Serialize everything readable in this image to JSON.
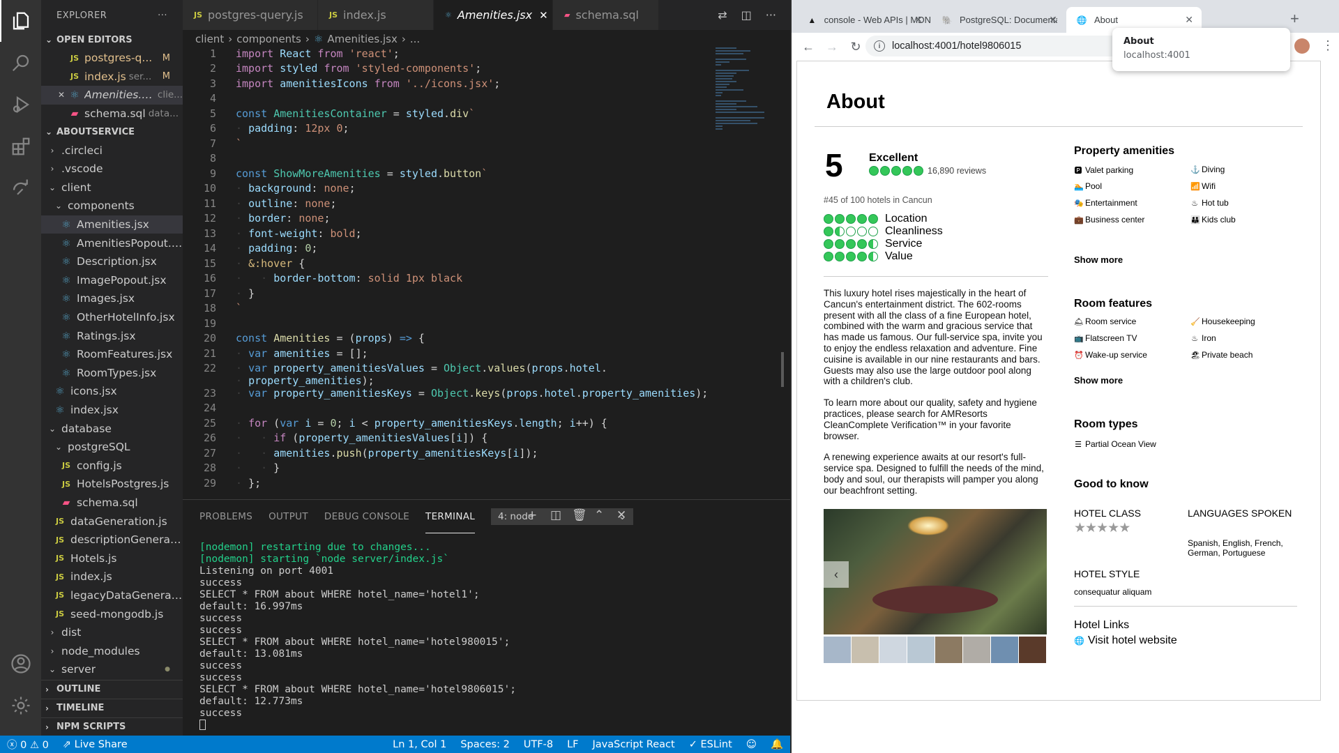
{
  "vscode": {
    "explorer_title": "EXPLORER",
    "open_editors_label": "OPEN EDITORS",
    "open_editors": [
      {
        "name": "postgres-q...",
        "icon": "JS",
        "badge": "M",
        "desc": ""
      },
      {
        "name": "index.js",
        "icon": "JS",
        "badge": "M",
        "desc": "ser..."
      },
      {
        "name": "Amenities.jsx",
        "icon": "react",
        "badge": "",
        "desc": "clie..."
      },
      {
        "name": "schema.sql",
        "icon": "sql",
        "badge": "",
        "desc": "data..."
      }
    ],
    "workspace_label": "ABOUTSERVICE",
    "tree": [
      {
        "name": ".circleci",
        "depth": 1,
        "type": "folder-closed"
      },
      {
        "name": ".vscode",
        "depth": 1,
        "type": "folder-closed"
      },
      {
        "name": "client",
        "depth": 1,
        "type": "folder-open"
      },
      {
        "name": "components",
        "depth": 2,
        "type": "folder-open"
      },
      {
        "name": "Amenities.jsx",
        "depth": 3,
        "type": "react"
      },
      {
        "name": "AmenitiesPopout.j...",
        "depth": 3,
        "type": "react"
      },
      {
        "name": "Description.jsx",
        "depth": 3,
        "type": "react"
      },
      {
        "name": "ImagePopout.jsx",
        "depth": 3,
        "type": "react"
      },
      {
        "name": "Images.jsx",
        "depth": 3,
        "type": "react"
      },
      {
        "name": "OtherHotelInfo.jsx",
        "depth": 3,
        "type": "react"
      },
      {
        "name": "Ratings.jsx",
        "depth": 3,
        "type": "react"
      },
      {
        "name": "RoomFeatures.jsx",
        "depth": 3,
        "type": "react"
      },
      {
        "name": "RoomTypes.jsx",
        "depth": 3,
        "type": "react"
      },
      {
        "name": "icons.jsx",
        "depth": 2,
        "type": "react"
      },
      {
        "name": "index.jsx",
        "depth": 2,
        "type": "react"
      },
      {
        "name": "database",
        "depth": 1,
        "type": "folder-open"
      },
      {
        "name": "postgreSQL",
        "depth": 2,
        "type": "folder-open"
      },
      {
        "name": "config.js",
        "depth": 3,
        "type": "js"
      },
      {
        "name": "HotelsPostgres.js",
        "depth": 3,
        "type": "js"
      },
      {
        "name": "schema.sql",
        "depth": 3,
        "type": "sql"
      },
      {
        "name": "dataGeneration.js",
        "depth": 2,
        "type": "js"
      },
      {
        "name": "descriptionGenerat...",
        "depth": 2,
        "type": "js"
      },
      {
        "name": "Hotels.js",
        "depth": 2,
        "type": "js"
      },
      {
        "name": "index.js",
        "depth": 2,
        "type": "js"
      },
      {
        "name": "legacyDataGenerati...",
        "depth": 2,
        "type": "js"
      },
      {
        "name": "seed-mongodb.js",
        "depth": 2,
        "type": "js"
      },
      {
        "name": "dist",
        "depth": 1,
        "type": "folder-closed"
      },
      {
        "name": "node_modules",
        "depth": 1,
        "type": "folder-closed"
      },
      {
        "name": "server",
        "depth": 1,
        "type": "folder-open"
      }
    ],
    "outline_label": "OUTLINE",
    "timeline_label": "TIMELINE",
    "npm_label": "NPM SCRIPTS",
    "tabs": [
      {
        "name": "postgres-query.js",
        "icon": "JS"
      },
      {
        "name": "index.js",
        "icon": "JS"
      },
      {
        "name": "Amenities.jsx",
        "icon": "react",
        "active": true
      },
      {
        "name": "schema.sql",
        "icon": "sql"
      }
    ],
    "breadcrumb": [
      "client",
      "components",
      "Amenities.jsx",
      "..."
    ],
    "line_numbers": [
      "1",
      "2",
      "3",
      "4",
      "5",
      "6",
      "7",
      "8",
      "9",
      "10",
      "11",
      "12",
      "13",
      "14",
      "15",
      "16",
      "17",
      "18",
      "19",
      "20",
      "21",
      "22",
      "",
      "23",
      "24",
      "25",
      "26",
      "27",
      "28",
      "29"
    ],
    "panel_tabs": [
      "PROBLEMS",
      "OUTPUT",
      "DEBUG CONSOLE",
      "TERMINAL"
    ],
    "terminal_select": "4: node",
    "terminal_lines": [
      {
        "text": "[nodemon] restarting due to changes...",
        "green": true
      },
      {
        "text": "[nodemon] starting `node server/index.js`",
        "green": true
      },
      {
        "text": "Listening on port 4001",
        "green": false
      },
      {
        "text": "success",
        "green": false
      },
      {
        "text": "SELECT * FROM about WHERE hotel_name='hotel1';",
        "green": false
      },
      {
        "text": "default: 16.997ms",
        "green": false
      },
      {
        "text": "success",
        "green": false
      },
      {
        "text": "success",
        "green": false
      },
      {
        "text": "SELECT * FROM about WHERE hotel_name='hotel980015';",
        "green": false
      },
      {
        "text": "default: 13.081ms",
        "green": false
      },
      {
        "text": "success",
        "green": false
      },
      {
        "text": "success",
        "green": false
      },
      {
        "text": "SELECT * FROM about WHERE hotel_name='hotel9806015';",
        "green": false
      },
      {
        "text": "default: 12.773ms",
        "green": false
      },
      {
        "text": "success",
        "green": false
      }
    ],
    "status": {
      "errors": "0",
      "warnings": "0",
      "live_share": "Live Share",
      "position": "Ln 1, Col 1",
      "spaces": "Spaces: 2",
      "encoding": "UTF-8",
      "eol": "LF",
      "language": "JavaScript React",
      "eslint": "ESLint"
    }
  },
  "chrome": {
    "tabs": [
      {
        "title": "console - Web APIs | MDN"
      },
      {
        "title": "PostgreSQL: Documentation"
      },
      {
        "title": "About",
        "active": true
      }
    ],
    "url": "localhost:4001/hotel9806015",
    "tooltip": {
      "title": "About",
      "host": "localhost:4001"
    }
  },
  "page": {
    "title": "About",
    "score": "5",
    "score_label": "Excellent",
    "reviews": "16,890 reviews",
    "rank": "#45 of 100 hotels in Cancun",
    "ratings": [
      {
        "label": "Location",
        "filled": 5,
        "half": 0
      },
      {
        "label": "Cleanliness",
        "filled": 1,
        "half": 1
      },
      {
        "label": "Service",
        "filled": 4,
        "half": 1
      },
      {
        "label": "Value",
        "filled": 4,
        "half": 1
      }
    ],
    "description": [
      "This luxury hotel rises majestically in the heart of Cancun's entertainment district. The 602-rooms present with all the class of a fine European hotel, combined with the warm and gracious service that has made us famous. Our full-service spa, invite you to enjoy the endless relaxation and adventure. Fine cuisine is available in our nine restaurants and bars. Guests may also use the large outdoor pool along with a children's club.",
      "To learn more about our quality, safety and hygiene practices, please search for AMResorts CleanComplete Verification™ in your favorite browser.",
      "A renewing experience awaits at our resort's full-service spa. Designed to fulfill the needs of the mind, body and soul, our therapists will pamper you along our beachfront setting."
    ],
    "property_amenities_title": "Property amenities",
    "property_amenities": [
      "Valet parking",
      "Diving",
      "Pool",
      "Wifi",
      "Entertainment",
      "Hot tub",
      "Business center",
      "Kids club"
    ],
    "show_more": "Show more",
    "room_features_title": "Room features",
    "room_features": [
      "Room service",
      "Housekeeping",
      "Flatscreen TV",
      "Iron",
      "Wake-up service",
      "Private beach"
    ],
    "room_types_title": "Room types",
    "room_types": [
      "Partial Ocean View"
    ],
    "good_to_know_title": "Good to know",
    "hotel_class_label": "HOTEL CLASS",
    "hotel_class_stars": 5,
    "languages_label": "LANGUAGES SPOKEN",
    "languages_value": "Spanish, English, French, German, Portuguese",
    "hotel_style_label": "HOTEL STYLE",
    "hotel_style_value": "consequatur aliquam",
    "hotel_links_title": "Hotel Links",
    "visit_website": "Visit hotel website",
    "thumb_colors": [
      "#a7b7c9",
      "#c8bfae",
      "#cfd7e0",
      "#b9c8d4",
      "#8c7a62",
      "#b0aca6",
      "#6f8fb0",
      "#5a3a2a"
    ]
  }
}
